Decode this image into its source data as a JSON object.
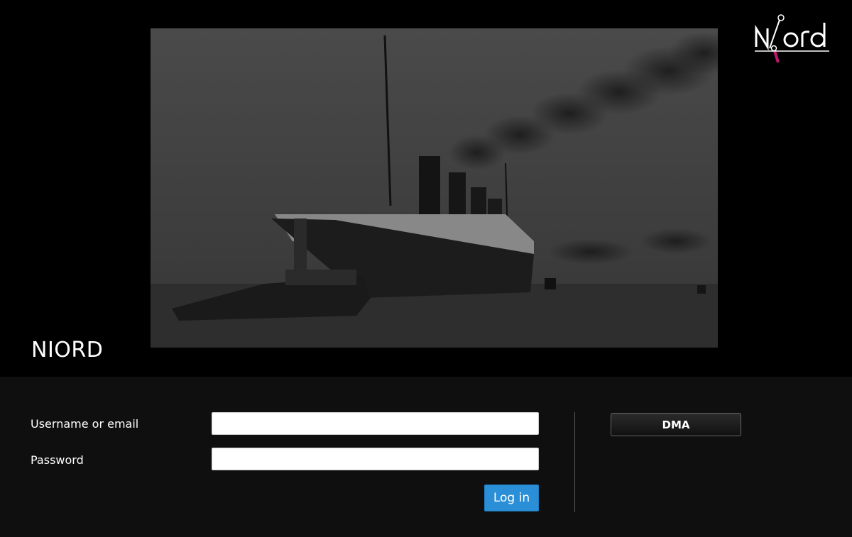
{
  "app": {
    "title": "NIORD"
  },
  "logo": {
    "text": "Niord",
    "accent_color": "#c0176e"
  },
  "hero": {
    "image": "steamship-with-tugboat-photo"
  },
  "login": {
    "username_label": "Username or email",
    "username_value": "",
    "password_label": "Password",
    "password_value": "",
    "submit_label": "Log in",
    "submit_color": "#2a8fd6"
  },
  "providers": {
    "dma_label": "DMA"
  }
}
